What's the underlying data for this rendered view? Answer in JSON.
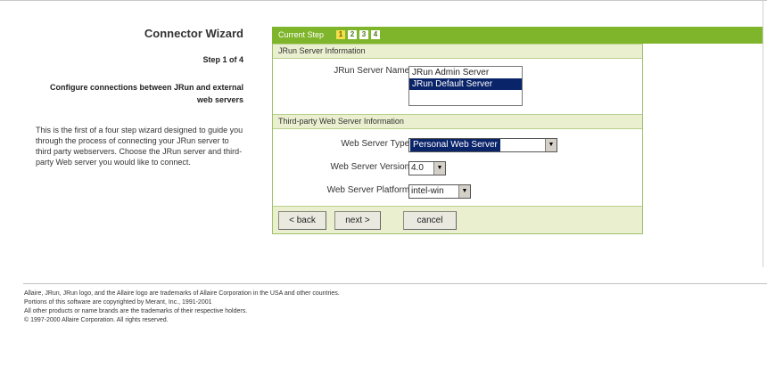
{
  "left": {
    "title": "Connector Wizard",
    "step_of": "Step 1 of 4",
    "configure": "Configure connections between JRun and external web servers",
    "description": "This is the first of a four step wizard designed to guide you through the process of connecting your JRun server to third party webservers. Choose the JRun server and third-party Web server you would like to connect."
  },
  "stepbar": {
    "label": "Current Step",
    "steps": [
      "1",
      "2",
      "3",
      "4"
    ],
    "active_step": 1
  },
  "jrun_section": {
    "heading": "JRun Server Information",
    "server_name_label": "JRun Server Name:",
    "servers": [
      "JRun Admin Server",
      "JRun Default Server"
    ],
    "selected_server": "JRun Default Server"
  },
  "web_section": {
    "heading": "Third-party Web Server Information",
    "type_label": "Web Server Type:",
    "type_value": "Personal Web Server",
    "version_label": "Web Server Version:",
    "version_value": "4.0",
    "platform_label": "Web Server Platform:",
    "platform_value": "intel-win"
  },
  "buttons": {
    "back": "< back",
    "next": "next >",
    "cancel": "cancel"
  },
  "footer": {
    "line1": "Allaire, JRun, JRun logo, and the Allaire logo are trademarks of Allaire Corporation in the USA and other countries.",
    "line2": "Portions of this software are copyrighted by Merant, Inc., 1991-2001",
    "line3": "All other products or name brands are the trademarks of their respective holders.",
    "line4": "© 1997-2000 Allaire Corporation. All rights reserved."
  },
  "colors": {
    "accent_green": "#7fb52b",
    "section_bg": "#e9efcf",
    "active_step": "#f3e04a",
    "selection": "#0a246a"
  }
}
